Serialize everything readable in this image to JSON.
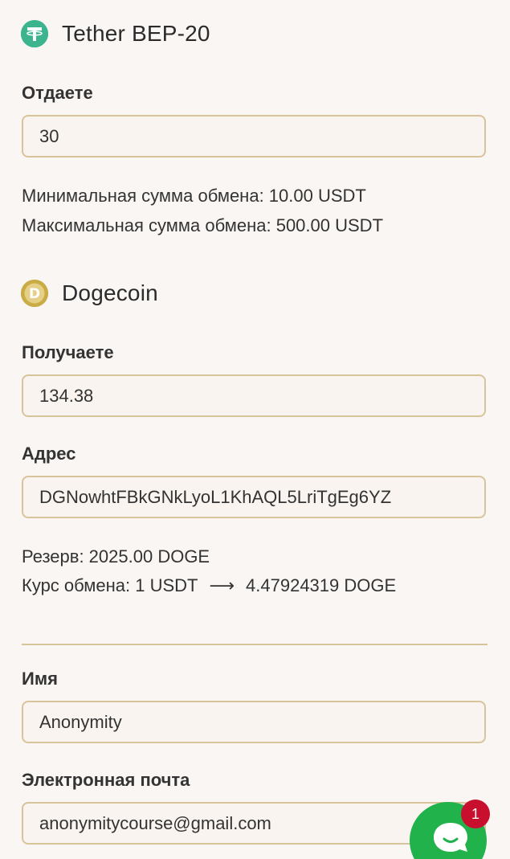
{
  "give": {
    "currency_name": "Tether BEP-20",
    "currency_icon": "tether-icon",
    "label": "Отдаете",
    "amount": "30",
    "min_text": "Минимальная сумма обмена: 10.00 USDT",
    "max_text": "Максимальная сумма обмена: 500.00 USDT"
  },
  "receive": {
    "currency_name": "Dogecoin",
    "currency_icon": "dogecoin-icon",
    "label": "Получаете",
    "amount": "134.38",
    "address_label": "Адрес",
    "address": "DGNowhtFBkGNkLyoL1KhAQL5LriTgEg6YZ",
    "reserve_text": "Резерв: 2025.00 DOGE",
    "rate_prefix": "Курс обмена: 1 USDT",
    "rate_arrow": "⟶",
    "rate_suffix": "4.47924319 DOGE"
  },
  "contact": {
    "name_label": "Имя",
    "name_value": "Anonymity",
    "email_label": "Электронная почта",
    "email_value": "anonymitycourse@gmail.com"
  },
  "chat": {
    "icon": "chat-icon",
    "badge_count": "1",
    "color": "#22b24c",
    "badge_color": "#c8102e"
  },
  "colors": {
    "background": "#faf6f3",
    "field_border": "#d8c49a",
    "tether_green": "#26a17b",
    "doge_gold": "#c2a633"
  }
}
